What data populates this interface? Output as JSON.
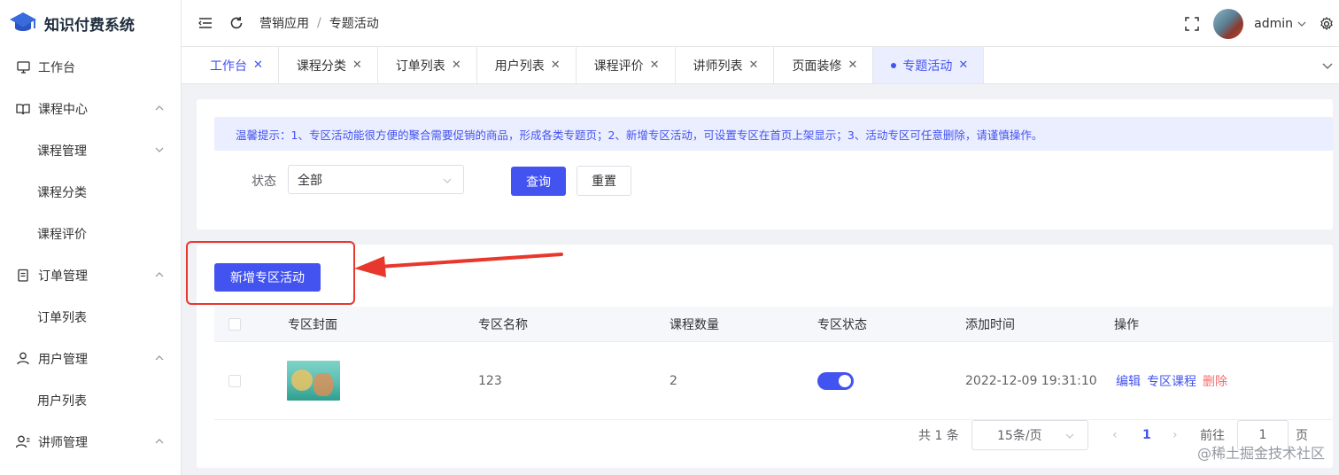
{
  "app": {
    "title": "知识付费系统"
  },
  "sidebar": {
    "items": [
      {
        "label": "工作台",
        "icon": "monitor-icon"
      },
      {
        "label": "课程中心",
        "icon": "book-icon"
      },
      {
        "label": "课程管理"
      },
      {
        "label": "课程分类"
      },
      {
        "label": "课程评价"
      },
      {
        "label": "订单管理",
        "icon": "clipboard-icon"
      },
      {
        "label": "订单列表"
      },
      {
        "label": "用户管理",
        "icon": "user-icon"
      },
      {
        "label": "用户列表"
      },
      {
        "label": "讲师管理",
        "icon": "teacher-icon"
      }
    ]
  },
  "header": {
    "breadcrumb": [
      "营销应用",
      "/",
      "专题活动"
    ],
    "username": "admin"
  },
  "tabs": [
    {
      "label": "工作台"
    },
    {
      "label": "课程分类"
    },
    {
      "label": "订单列表"
    },
    {
      "label": "用户列表"
    },
    {
      "label": "课程评价"
    },
    {
      "label": "讲师列表"
    },
    {
      "label": "页面装修"
    },
    {
      "label": "专题活动",
      "active": true
    }
  ],
  "tab_close": "✕",
  "alert": {
    "text": "温馨提示：1、专区活动能很方便的聚合需要促销的商品，形成各类专题页；2、新增专区活动，可设置专区在首页上架显示；3、活动专区可任意删除，请谨慎操作。"
  },
  "filter": {
    "status_label": "状态",
    "status_value": "全部",
    "search_label": "查询",
    "reset_label": "重置"
  },
  "actions": {
    "add_label": "新增专区活动"
  },
  "table": {
    "columns": [
      "专区封面",
      "专区名称",
      "课程数量",
      "专区状态",
      "添加时间",
      "操作"
    ],
    "rows": [
      {
        "name": "123",
        "count": "2",
        "status_on": true,
        "added": "2022-12-09 19:31:10",
        "ops": [
          "编辑",
          "专区课程",
          "删除"
        ]
      }
    ]
  },
  "pagination": {
    "total": "共 1 条",
    "page_size": "15条/页",
    "prev": "‹",
    "current": "1",
    "next": "›",
    "goto_label": "前往",
    "goto_value": "1",
    "page_suffix": "页"
  },
  "watermark": "@稀土掘金技术社区",
  "colors": {
    "primary": "#4353f0",
    "danger": "#f56c6c",
    "highlight": "#e8382e"
  }
}
